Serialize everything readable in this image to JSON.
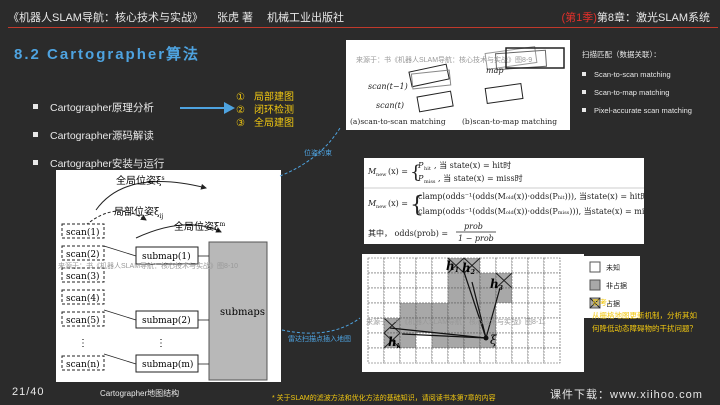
{
  "header": {
    "book": "《机器人SLAM导航：核心技术与实战》",
    "author": "张虎 著",
    "publisher": "机械工业出版社",
    "episode": "(第1季)",
    "chapter": "第8章：激光SLAM系统"
  },
  "title": "8.2 Cartographer算法",
  "bullets": [
    "Cartographer原理分析",
    "Cartographer源码解读",
    "Cartographer安装与运行"
  ],
  "sublist": [
    {
      "n": "①",
      "t": "局部建图"
    },
    {
      "n": "②",
      "t": "闭环检测"
    },
    {
      "n": "③",
      "t": "全局建图"
    }
  ],
  "right_side": {
    "heading": "扫描匹配（数据关联）：",
    "items": [
      "Scan-to-scan matching",
      "Scan-to-map matching",
      "Pixel-accurate scan matching"
    ]
  },
  "think": {
    "h": "思考：",
    "l1": "从栅格地图更新机制，分析其如",
    "l2": "何降低动态障碍物的干扰问题？"
  },
  "links": {
    "pose": "位姿约束",
    "insert": "雷达扫描点插入地图"
  },
  "fig1": {
    "watermark": "来源于：书《机器人SLAM导航：核心技术与实战》图8-9",
    "map": "map",
    "scan_t1": "scan(t−1)",
    "scan_t": "scan(t)",
    "cap_a": "(a)scan-to-scan matching",
    "cap_b": "(b)scan-to-map matching"
  },
  "fig3": {
    "watermark": "来源于：书《机器人SLAM导航：核心技术与实战》图8-10",
    "global_pose1": "全局位姿ξ",
    "global_pose1_sup": "s",
    "local_pose": "局部位姿ξ",
    "local_pose_sub": "ij",
    "global_pose2": "全局位姿ξ",
    "global_pose2_sup": "m",
    "scans": [
      "scan(1)",
      "scan(2)",
      "scan(3)",
      "scan(4)",
      "scan(5)",
      "⋮",
      "scan(n)"
    ],
    "submaps": [
      "submap(1)",
      "submap(2)",
      "⋮",
      "submap(m)"
    ],
    "big": "submaps"
  },
  "fig4": {
    "watermark": "来源于：书《机器人SLAM导航：核心技术与实战》图8-11",
    "h1": "h",
    "h2": "h",
    "h3": "h",
    "hk": "h",
    "xi": "ξ",
    "legend": [
      "未知",
      "非占据",
      "占据"
    ]
  },
  "footer": {
    "page": "21/40",
    "caption": "Cartographer地图结构",
    "note": "* 关于SLAM的滤波方法和优化方法的基础知识，请阅读书本第7章的内容",
    "download": "课件下载：www.xiihoo.com"
  },
  "colors": {
    "accent": "#4ea3e0",
    "highlight": "#f2c811",
    "red": "#e0302a"
  }
}
